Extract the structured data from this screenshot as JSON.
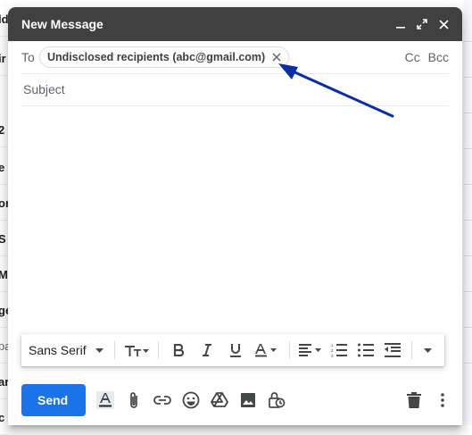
{
  "background_rows": [
    "ld",
    "ir",
    "2",
    "e",
    "or",
    "S",
    "My",
    "ge",
    "pa",
    "ar",
    "c"
  ],
  "compose": {
    "title": "New Message",
    "controls": [
      "minimize-icon",
      "expand-icon",
      "close-icon"
    ],
    "to_label": "To",
    "recipient_chip": "Undisclosed recipients (abc@gmail.com)",
    "cc_label": "Cc",
    "bcc_label": "Bcc",
    "subject_placeholder": "Subject",
    "subject_value": ""
  },
  "format_toolbar": {
    "font_family": "Sans Serif",
    "buttons": [
      "text-size-icon",
      "bold-icon",
      "italic-icon",
      "underline-icon",
      "text-color-icon",
      "align-icon",
      "numbered-list-icon",
      "bulleted-list-icon",
      "indent-less-icon",
      "more-formatting-icon"
    ]
  },
  "bottom_toolbar": {
    "send_label": "Send",
    "icons": [
      "formatting-options-icon",
      "attach-icon",
      "link-icon",
      "emoji-icon",
      "drive-icon",
      "photo-icon",
      "confidential-icon",
      "trash-icon",
      "more-options-icon"
    ]
  },
  "annotation": {
    "arrow_color": "#0a2ea6"
  },
  "colors": {
    "titlebar": "#404040",
    "send": "#1a73e8"
  }
}
